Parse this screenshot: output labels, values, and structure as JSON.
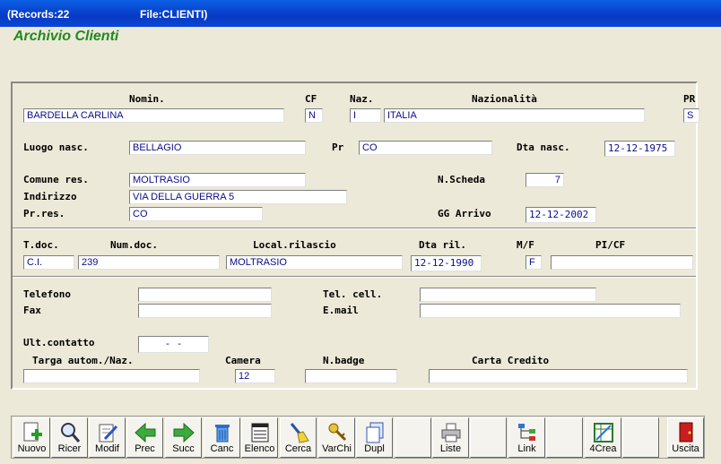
{
  "window": {
    "records": "(Records:22",
    "file": "File:CLIENTI)"
  },
  "app_title": "Archivio Clienti",
  "labels": {
    "nomin": "Nomin.",
    "cf": "CF",
    "naz": "Naz.",
    "nazionalita": "Nazionalità",
    "pr": "PR",
    "luogo_nasc": "Luogo nasc.",
    "pr2": "Pr",
    "dta_nasc": "Dta nasc.",
    "comune_res": "Comune res.",
    "n_scheda": "N.Scheda",
    "indirizzo": "Indirizzo",
    "pr_res": "Pr.res.",
    "gg_arrivo": "GG Arrivo",
    "t_doc": "T.doc.",
    "num_doc": "Num.doc.",
    "local_rilascio": "Local.rilascio",
    "dta_ril": "Dta ril.",
    "mf": "M/F",
    "pi_cf": "PI/CF",
    "telefono": "Telefono",
    "tel_cell": "Tel. cell.",
    "fax": "Fax",
    "email": "E.mail",
    "ult_contatto": "Ult.contatto",
    "targa": "Targa autom./Naz.",
    "camera": "Camera",
    "n_badge": "N.badge",
    "carta_credito": "Carta Credito"
  },
  "fields": {
    "nomin": "BARDELLA CARLINA",
    "cf": "N",
    "naz": "I",
    "nazionalita": "ITALIA",
    "pr": "S",
    "luogo_nasc": "BELLAGIO",
    "pr2": "CO",
    "dta_nasc": "12-12-1975",
    "comune_res": "MOLTRASIO",
    "n_scheda": "7",
    "indirizzo": "VIA DELLA GUERRA 5",
    "pr_res": "CO",
    "gg_arrivo": "12-12-2002",
    "t_doc": "C.I.",
    "num_doc": "239",
    "local_rilascio": "MOLTRASIO",
    "dta_ril": "12-12-1990",
    "mf": "F",
    "pi_cf": "",
    "telefono": "",
    "tel_cell": "",
    "fax": "",
    "email": "",
    "ult_contatto": "-  -",
    "targa": "",
    "camera": "12",
    "n_badge": "",
    "carta_credito": ""
  },
  "toolbar": {
    "nuovo": "Nuovo",
    "ricer": "Ricer",
    "modif": "Modif",
    "prec": "Prec",
    "succ": "Succ",
    "canc": "Canc",
    "elenco": "Elenco",
    "cerca": "Cerca",
    "varchi": "VarChi",
    "dupl": "Dupl",
    "liste": "Liste",
    "link": "Link",
    "crea": "4Crea",
    "uscita": "Uscita"
  },
  "icons": [
    "new-doc-icon",
    "magnifier-icon",
    "edit-doc-icon",
    "arrow-left-icon",
    "arrow-right-icon",
    "trash-icon",
    "list-icon",
    "broom-icon",
    "keys-icon",
    "copy-icon",
    "printer-icon",
    "tree-icon",
    "table-icon",
    "exit-door-icon"
  ],
  "colors": {
    "accent_title": "#1f8a1f",
    "field_text": "#0b0b8c",
    "titlebar": "#0a46d6"
  }
}
